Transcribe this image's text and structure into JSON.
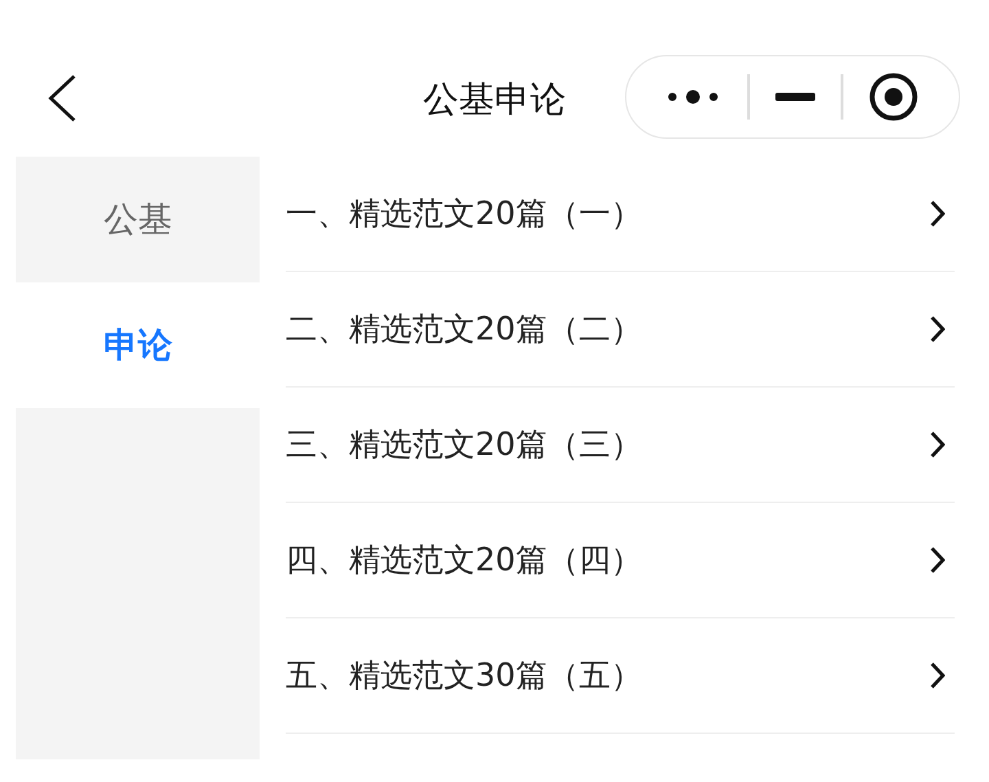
{
  "header": {
    "title": "公基申论"
  },
  "sidebar": {
    "items": [
      {
        "label": "公基",
        "selected": false
      },
      {
        "label": "申论",
        "selected": true
      }
    ]
  },
  "list": {
    "items": [
      {
        "label": "一、精选范文20篇（一）"
      },
      {
        "label": "二、精选范文20篇（二）"
      },
      {
        "label": "三、精选范文20篇（三）"
      },
      {
        "label": "四、精选范文20篇（四）"
      },
      {
        "label": "五、精选范文30篇（五）"
      }
    ]
  }
}
